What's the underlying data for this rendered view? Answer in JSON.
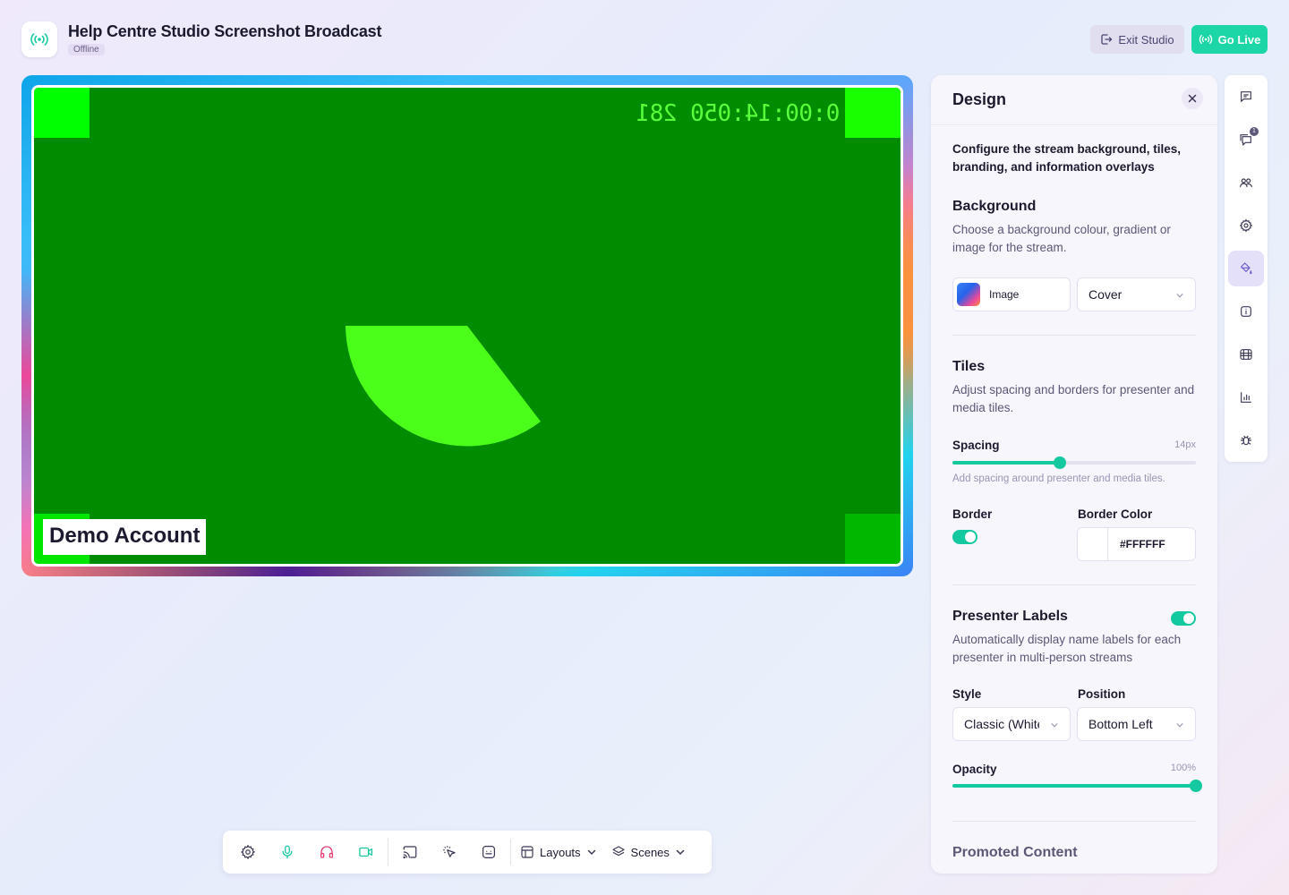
{
  "header": {
    "title": "Help Centre Studio Screenshot Broadcast",
    "status": "Offline",
    "exit_label": "Exit Studio",
    "golive_label": "Go Live"
  },
  "stage": {
    "timecode": "0:00:14:050 281",
    "presenter_name": "Demo Account"
  },
  "toolbar": {
    "layouts_label": "Layouts",
    "scenes_label": "Scenes",
    "icons": [
      "settings-icon",
      "microphone-icon",
      "headphones-icon",
      "camera-icon",
      "cast-icon",
      "pointer-icon",
      "captions-icon"
    ]
  },
  "design_panel": {
    "title": "Design",
    "intro": "Configure the stream background, tiles, branding, and information overlays",
    "background": {
      "title": "Background",
      "description": "Choose a background colour, gradient or image for the stream.",
      "type_label": "Image",
      "fit_value": "Cover"
    },
    "tiles": {
      "title": "Tiles",
      "description": "Adjust spacing and borders for presenter and media tiles.",
      "spacing_label": "Spacing",
      "spacing_value": "14px",
      "spacing_fraction": 0.44,
      "spacing_hint": "Add spacing around presenter and media tiles.",
      "border_label": "Border",
      "border_on": true,
      "border_color_label": "Border Color",
      "border_color_value": "#FFFFFF"
    },
    "presenter_labels": {
      "title": "Presenter Labels",
      "enabled": true,
      "description": "Automatically display name labels for each presenter in multi-person streams",
      "style_label": "Style",
      "style_value": "Classic (White)",
      "position_label": "Position",
      "position_value": "Bottom Left",
      "opacity_label": "Opacity",
      "opacity_value": "100%",
      "opacity_fraction": 1.0
    },
    "promoted": {
      "title": "Promoted Content"
    }
  },
  "rail": {
    "items": [
      "chat-icon",
      "questions-icon",
      "participants-icon",
      "settings-icon",
      "design-icon",
      "info-icon",
      "media-icon",
      "analytics-icon",
      "debug-icon"
    ],
    "questions_badge": "1",
    "active": "design-icon"
  },
  "colors": {
    "accent": "#1dd6a8",
    "tile_bg": "#008c00",
    "timecode": "#59ff3a"
  }
}
